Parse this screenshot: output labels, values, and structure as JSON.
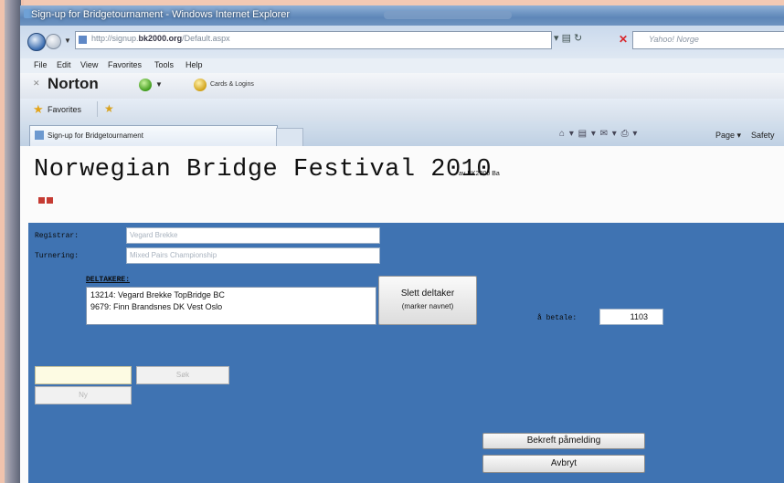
{
  "window": {
    "title": "Sign-up for Bridgetournament - Windows Internet Explorer"
  },
  "address": {
    "url_prefix": "http://signup.",
    "url_domain": "bk2000.org",
    "url_path": "/Default.aspx",
    "search_placeholder": "Yahoo! Norge"
  },
  "menu": [
    "File",
    "Edit",
    "View",
    "Favorites",
    "Tools",
    "Help"
  ],
  "norton": {
    "label": "Norton",
    "cards_label": "Cards & Logins"
  },
  "favorites": {
    "label": "Favorites"
  },
  "tab": {
    "label": "Sign-up for Bridgetournament",
    "page_menu": "Page",
    "safety_menu": "Safety"
  },
  "page": {
    "title": "Norwegian Bridge Festival 2010",
    "title_suffix": "av BK2000 Ba",
    "registrar_label": "Registrar:",
    "registrar_value": "Vegard Brekke",
    "tournament_label": "Turnering:",
    "tournament_value": "Mixed Pairs Championship",
    "participants_label": "DELTAKERE:",
    "participants": [
      "13214: Vegard Brekke TopBridge BC",
      "9679: Finn Brandsnes DK Vest Oslo"
    ],
    "delete_button_line1": "Slett deltaker",
    "delete_button_line2": "(marker navnet)",
    "to_pay_label": "å betale:",
    "amount": "1103",
    "search_button": "Søk",
    "new_button": "Ny",
    "confirm_button": "Bekreft påmelding",
    "cancel_button": "Avbryt"
  }
}
